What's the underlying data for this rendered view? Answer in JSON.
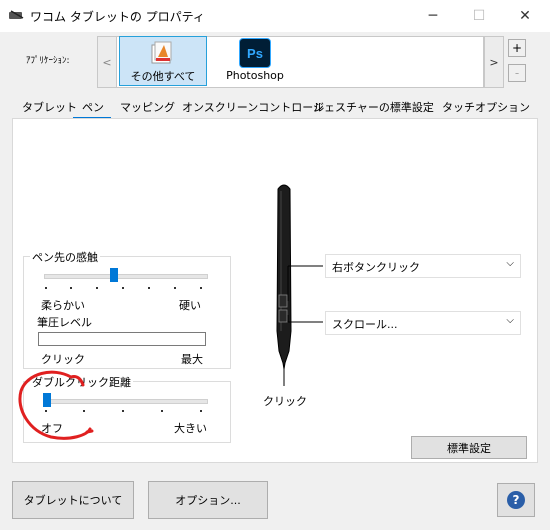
{
  "window": {
    "title": "ワコム タブレットの プロパティ",
    "icon": "tablet-icon"
  },
  "apps": {
    "label": "ｱﾌﾟﾘｹｰｼｮﾝ:",
    "items": [
      {
        "label": "その他すべて",
        "icon": "all-apps-icon",
        "selected": true
      },
      {
        "label": "Photoshop",
        "icon": "photoshop-icon",
        "icon_text": "Ps",
        "selected": false
      }
    ],
    "scroll_left": "<",
    "scroll_right": ">",
    "add": "+",
    "remove": "-"
  },
  "tabs": [
    "タブレット",
    "ペン",
    "マッピング",
    "オンスクリーンコントロール",
    "ジェスチャーの標準設定",
    "タッチオプション"
  ],
  "active_tab": "ペン",
  "pen_feel": {
    "label": "ペン先の感触",
    "soft": "柔らかい",
    "firm": "硬い",
    "value_fraction": 0.43,
    "pressure_label": "筆圧レベル",
    "click": "クリック",
    "max": "最大"
  },
  "double_click": {
    "label": "ダブルクリック距離",
    "off": "オフ",
    "large": "大きい",
    "value_fraction": 0.0
  },
  "pen_buttons": {
    "upper": "右ボタンクリック",
    "lower": "スクロール...",
    "tip": "クリック"
  },
  "buttons": {
    "defaults": "標準設定",
    "about": "タブレットについて",
    "options": "オプション...",
    "help": "?"
  },
  "colors": {
    "accent": "#0078d7",
    "annotation": "#e02020"
  }
}
